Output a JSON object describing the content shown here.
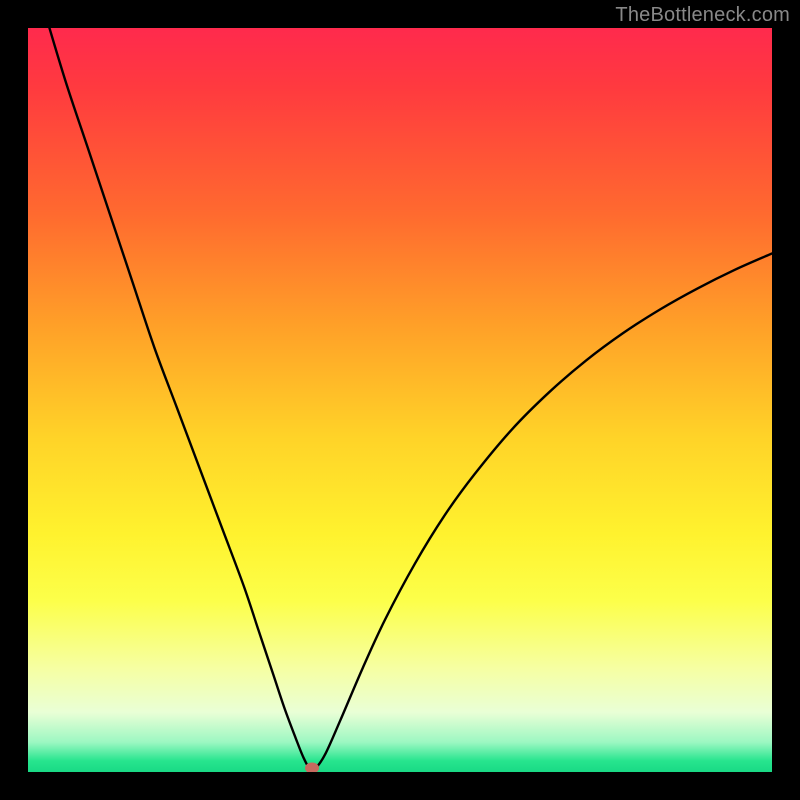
{
  "watermark": "TheBottleneck.com",
  "colors": {
    "frame": "#000000",
    "curve_stroke": "#000000",
    "marker_fill": "#c76a5f"
  },
  "chart_data": {
    "type": "line",
    "title": "",
    "xlabel": "",
    "ylabel": "",
    "xlim": [
      0,
      100
    ],
    "ylim": [
      0,
      100
    ],
    "grid": false,
    "legend": false,
    "description": "Bottleneck percentage curve with V-shaped minimum (green=low, red=high)",
    "series": [
      {
        "name": "bottleneck_curve",
        "x": [
          0,
          2,
          5,
          8,
          11,
          14,
          17,
          20,
          23,
          26,
          29,
          31,
          33,
          34.5,
          36,
          37,
          37.8,
          38.7,
          40,
          42,
          45,
          48,
          52,
          56,
          60,
          65,
          70,
          75,
          80,
          85,
          90,
          95,
          100
        ],
        "y": [
          110,
          103,
          93,
          84,
          75,
          66,
          57,
          49,
          41,
          33,
          25,
          19,
          13,
          8.5,
          4.5,
          2,
          0.6,
          0.6,
          2.5,
          7,
          14,
          20.5,
          28,
          34.5,
          40,
          46,
          51,
          55.3,
          59,
          62.2,
          65,
          67.5,
          69.7
        ]
      }
    ],
    "marker": {
      "name": "optimal_point",
      "x": 38.2,
      "y": 0.5
    },
    "gradient_stops": [
      {
        "pos": 0.0,
        "color": "#ff2a4d"
      },
      {
        "pos": 0.55,
        "color": "#ffd328"
      },
      {
        "pos": 0.77,
        "color": "#fcff4a"
      },
      {
        "pos": 1.0,
        "color": "#19d985"
      }
    ]
  }
}
